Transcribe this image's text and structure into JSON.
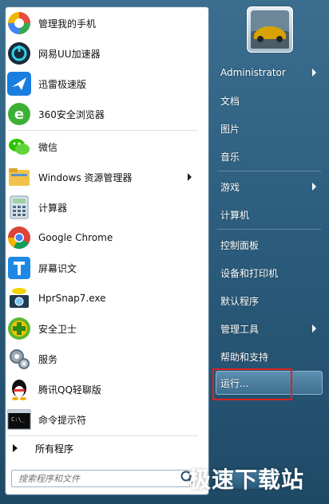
{
  "start_menu": {
    "programs": [
      {
        "label": "管理我的手机",
        "icon": "phone-manager-icon"
      },
      {
        "label": "网易UU加速器",
        "icon": "uu-accelerator-icon"
      },
      {
        "label": "迅雷极速版",
        "icon": "xunlei-icon"
      },
      {
        "label": "360安全浏览器",
        "icon": "360-browser-icon"
      },
      {
        "label": "微信",
        "icon": "wechat-icon"
      },
      {
        "label": "Windows 资源管理器",
        "icon": "explorer-icon",
        "submenu": true
      },
      {
        "label": "计算器",
        "icon": "calculator-icon"
      },
      {
        "label": "Google Chrome",
        "icon": "chrome-icon"
      },
      {
        "label": "屏幕识文",
        "icon": "screen-ocr-icon"
      },
      {
        "label": "HprSnap7.exe",
        "icon": "hprsnap-icon"
      },
      {
        "label": "安全卫士",
        "icon": "security-guard-icon"
      },
      {
        "label": "服务",
        "icon": "services-icon"
      },
      {
        "label": "腾讯QQ轻聊版",
        "icon": "qq-icon"
      },
      {
        "label": "命令提示符",
        "icon": "cmd-icon"
      }
    ],
    "all_programs": "所有程序",
    "search_placeholder": "搜索程序和文件",
    "right_items": [
      {
        "label": "Administrator",
        "submenu": true
      },
      {
        "label": "文档"
      },
      {
        "label": "图片"
      },
      {
        "label": "音乐"
      },
      {
        "label": "游戏",
        "submenu": true
      },
      {
        "label": "计算机"
      },
      {
        "label": "控制面板"
      },
      {
        "label": "设备和打印机"
      },
      {
        "label": "默认程序"
      },
      {
        "label": "管理工具",
        "submenu": true
      },
      {
        "label": "帮助和支持"
      },
      {
        "label": "运行..."
      }
    ]
  },
  "watermark": "极速下载站",
  "colors": {
    "panel_bg": "#2d5f80",
    "highlight": "#e02020"
  }
}
